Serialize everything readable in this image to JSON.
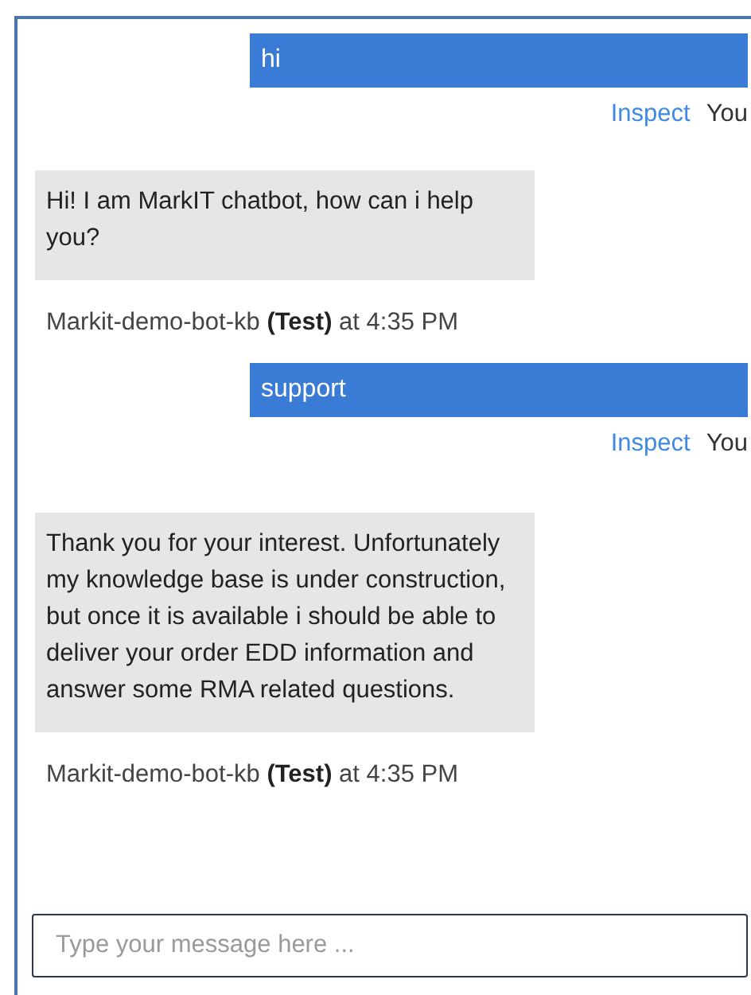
{
  "messages": [
    {
      "kind": "user",
      "text": "hi",
      "link": "Inspect",
      "sender": "You"
    },
    {
      "kind": "bot",
      "text": "Hi! I am MarkIT chatbot, how can i help you?",
      "meta": "Markit-demo-bot-kb **(Test)** at 4:35 PM"
    },
    {
      "kind": "user",
      "text": "support",
      "link": "Inspect",
      "sender": "You"
    },
    {
      "kind": "bot",
      "text": "Thank you for your interest. Unfortunately my knowledge base is under construction, but once it is available i should be able to deliver your order EDD information and answer some RMA related questions.",
      "meta": "Markit-demo-bot-kb **(Test)** at 4:35 PM"
    }
  ],
  "input": {
    "placeholder": "Type your message here ..."
  }
}
